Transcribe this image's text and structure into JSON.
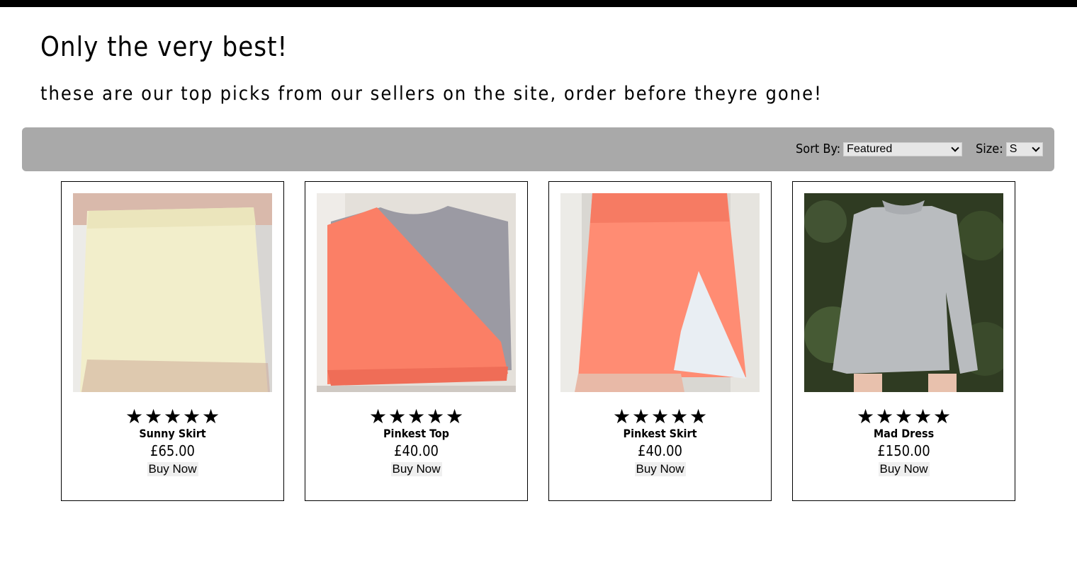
{
  "header": {
    "title": "Only the very best!",
    "subtitle": "these are our top picks from our sellers on the site, order before theyre gone!"
  },
  "filters": {
    "sort_label": "Sort By:",
    "sort_value": "Featured",
    "size_label": "Size:",
    "size_value": "S"
  },
  "rating_glyph": "★",
  "products": [
    {
      "name": "Sunny Skirt",
      "price": "£65.00",
      "button": "Buy Now",
      "rating": 5,
      "color": "#f3efc9"
    },
    {
      "name": "Pinkest Top",
      "price": "£40.00",
      "button": "Buy Now",
      "rating": 5,
      "color": "#fb7f66"
    },
    {
      "name": "Pinkest Skirt",
      "price": "£40.00",
      "button": "Buy Now",
      "rating": 5,
      "color": "#ff8c73"
    },
    {
      "name": "Mad Dress",
      "price": "£150.00",
      "button": "Buy Now",
      "rating": 5,
      "color": "#b9bcbf"
    }
  ]
}
